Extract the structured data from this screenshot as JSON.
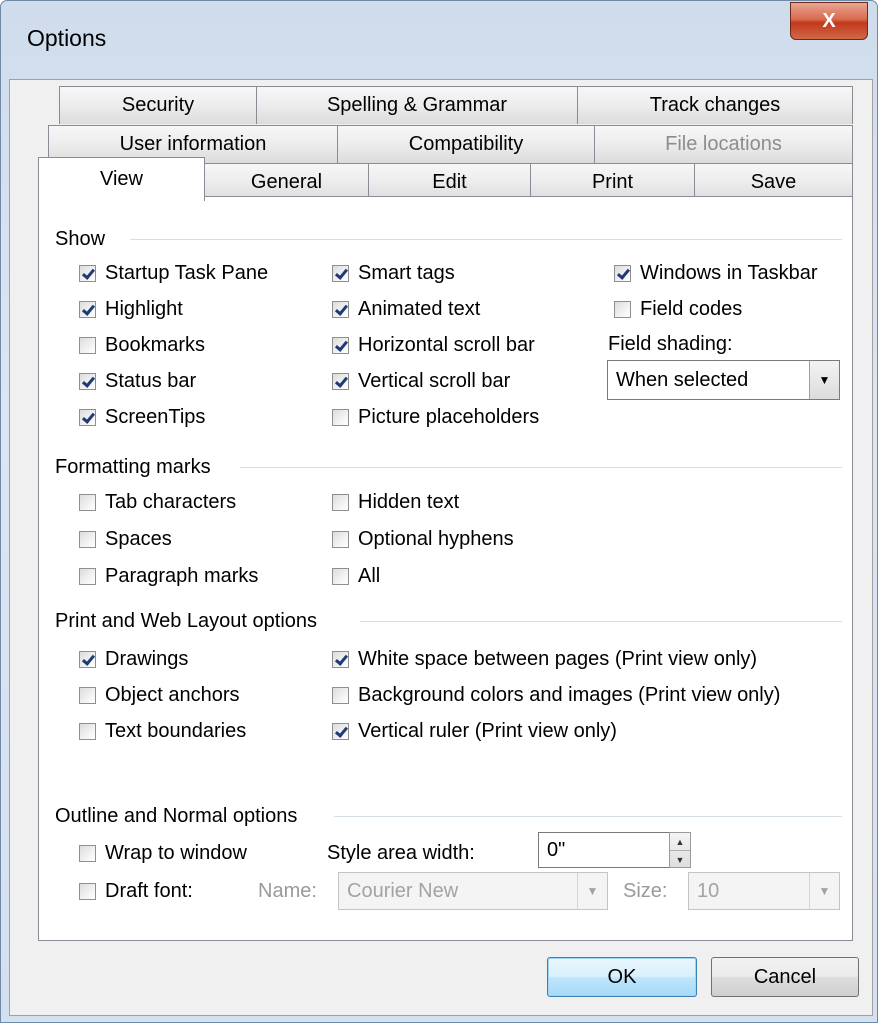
{
  "window": {
    "title": "Options",
    "close_label": "X"
  },
  "tabs": {
    "row1": [
      "Security",
      "Spelling & Grammar",
      "Track changes"
    ],
    "row2": [
      "User information",
      "Compatibility",
      "File locations"
    ],
    "row3": [
      "View",
      "General",
      "Edit",
      "Print",
      "Save"
    ],
    "active": "View",
    "disabled": "File locations"
  },
  "show": {
    "label": "Show",
    "col1": [
      {
        "label": "Startup Task Pane",
        "checked": true
      },
      {
        "label": "Highlight",
        "checked": true
      },
      {
        "label": "Bookmarks",
        "checked": false
      },
      {
        "label": "Status bar",
        "checked": true
      },
      {
        "label": "ScreenTips",
        "checked": true
      }
    ],
    "col2": [
      {
        "label": "Smart tags",
        "checked": true
      },
      {
        "label": "Animated text",
        "checked": true
      },
      {
        "label": "Horizontal scroll bar",
        "checked": true
      },
      {
        "label": "Vertical scroll bar",
        "checked": true
      },
      {
        "label": "Picture placeholders",
        "checked": false
      }
    ],
    "col3": [
      {
        "label": "Windows in Taskbar",
        "checked": true
      },
      {
        "label": "Field codes",
        "checked": false
      }
    ],
    "field_shading_label": "Field shading:",
    "field_shading_value": "When selected"
  },
  "formatting": {
    "label": "Formatting marks",
    "col1": [
      {
        "label": "Tab characters",
        "checked": false
      },
      {
        "label": "Spaces",
        "checked": false
      },
      {
        "label": "Paragraph marks",
        "checked": false
      }
    ],
    "col2": [
      {
        "label": "Hidden text",
        "checked": false
      },
      {
        "label": "Optional hyphens",
        "checked": false
      },
      {
        "label": "All",
        "checked": false
      }
    ]
  },
  "print_web": {
    "label": "Print and Web Layout options",
    "col1": [
      {
        "label": "Drawings",
        "checked": true
      },
      {
        "label": "Object anchors",
        "checked": false
      },
      {
        "label": "Text boundaries",
        "checked": false
      }
    ],
    "col2": [
      {
        "label": "White space between pages (Print view only)",
        "checked": true
      },
      {
        "label": "Background colors and images (Print view only)",
        "checked": false
      },
      {
        "label": "Vertical ruler (Print view only)",
        "checked": true
      }
    ]
  },
  "outline": {
    "label": "Outline and Normal options",
    "wrap": {
      "label": "Wrap to window",
      "checked": false
    },
    "draft": {
      "label": "Draft font:",
      "checked": false
    },
    "style_area_label": "Style area width:",
    "style_area_value": "0\"",
    "name_label": "Name:",
    "name_value": "Courier New",
    "size_label": "Size:",
    "size_value": "10"
  },
  "buttons": {
    "ok": "OK",
    "cancel": "Cancel"
  }
}
